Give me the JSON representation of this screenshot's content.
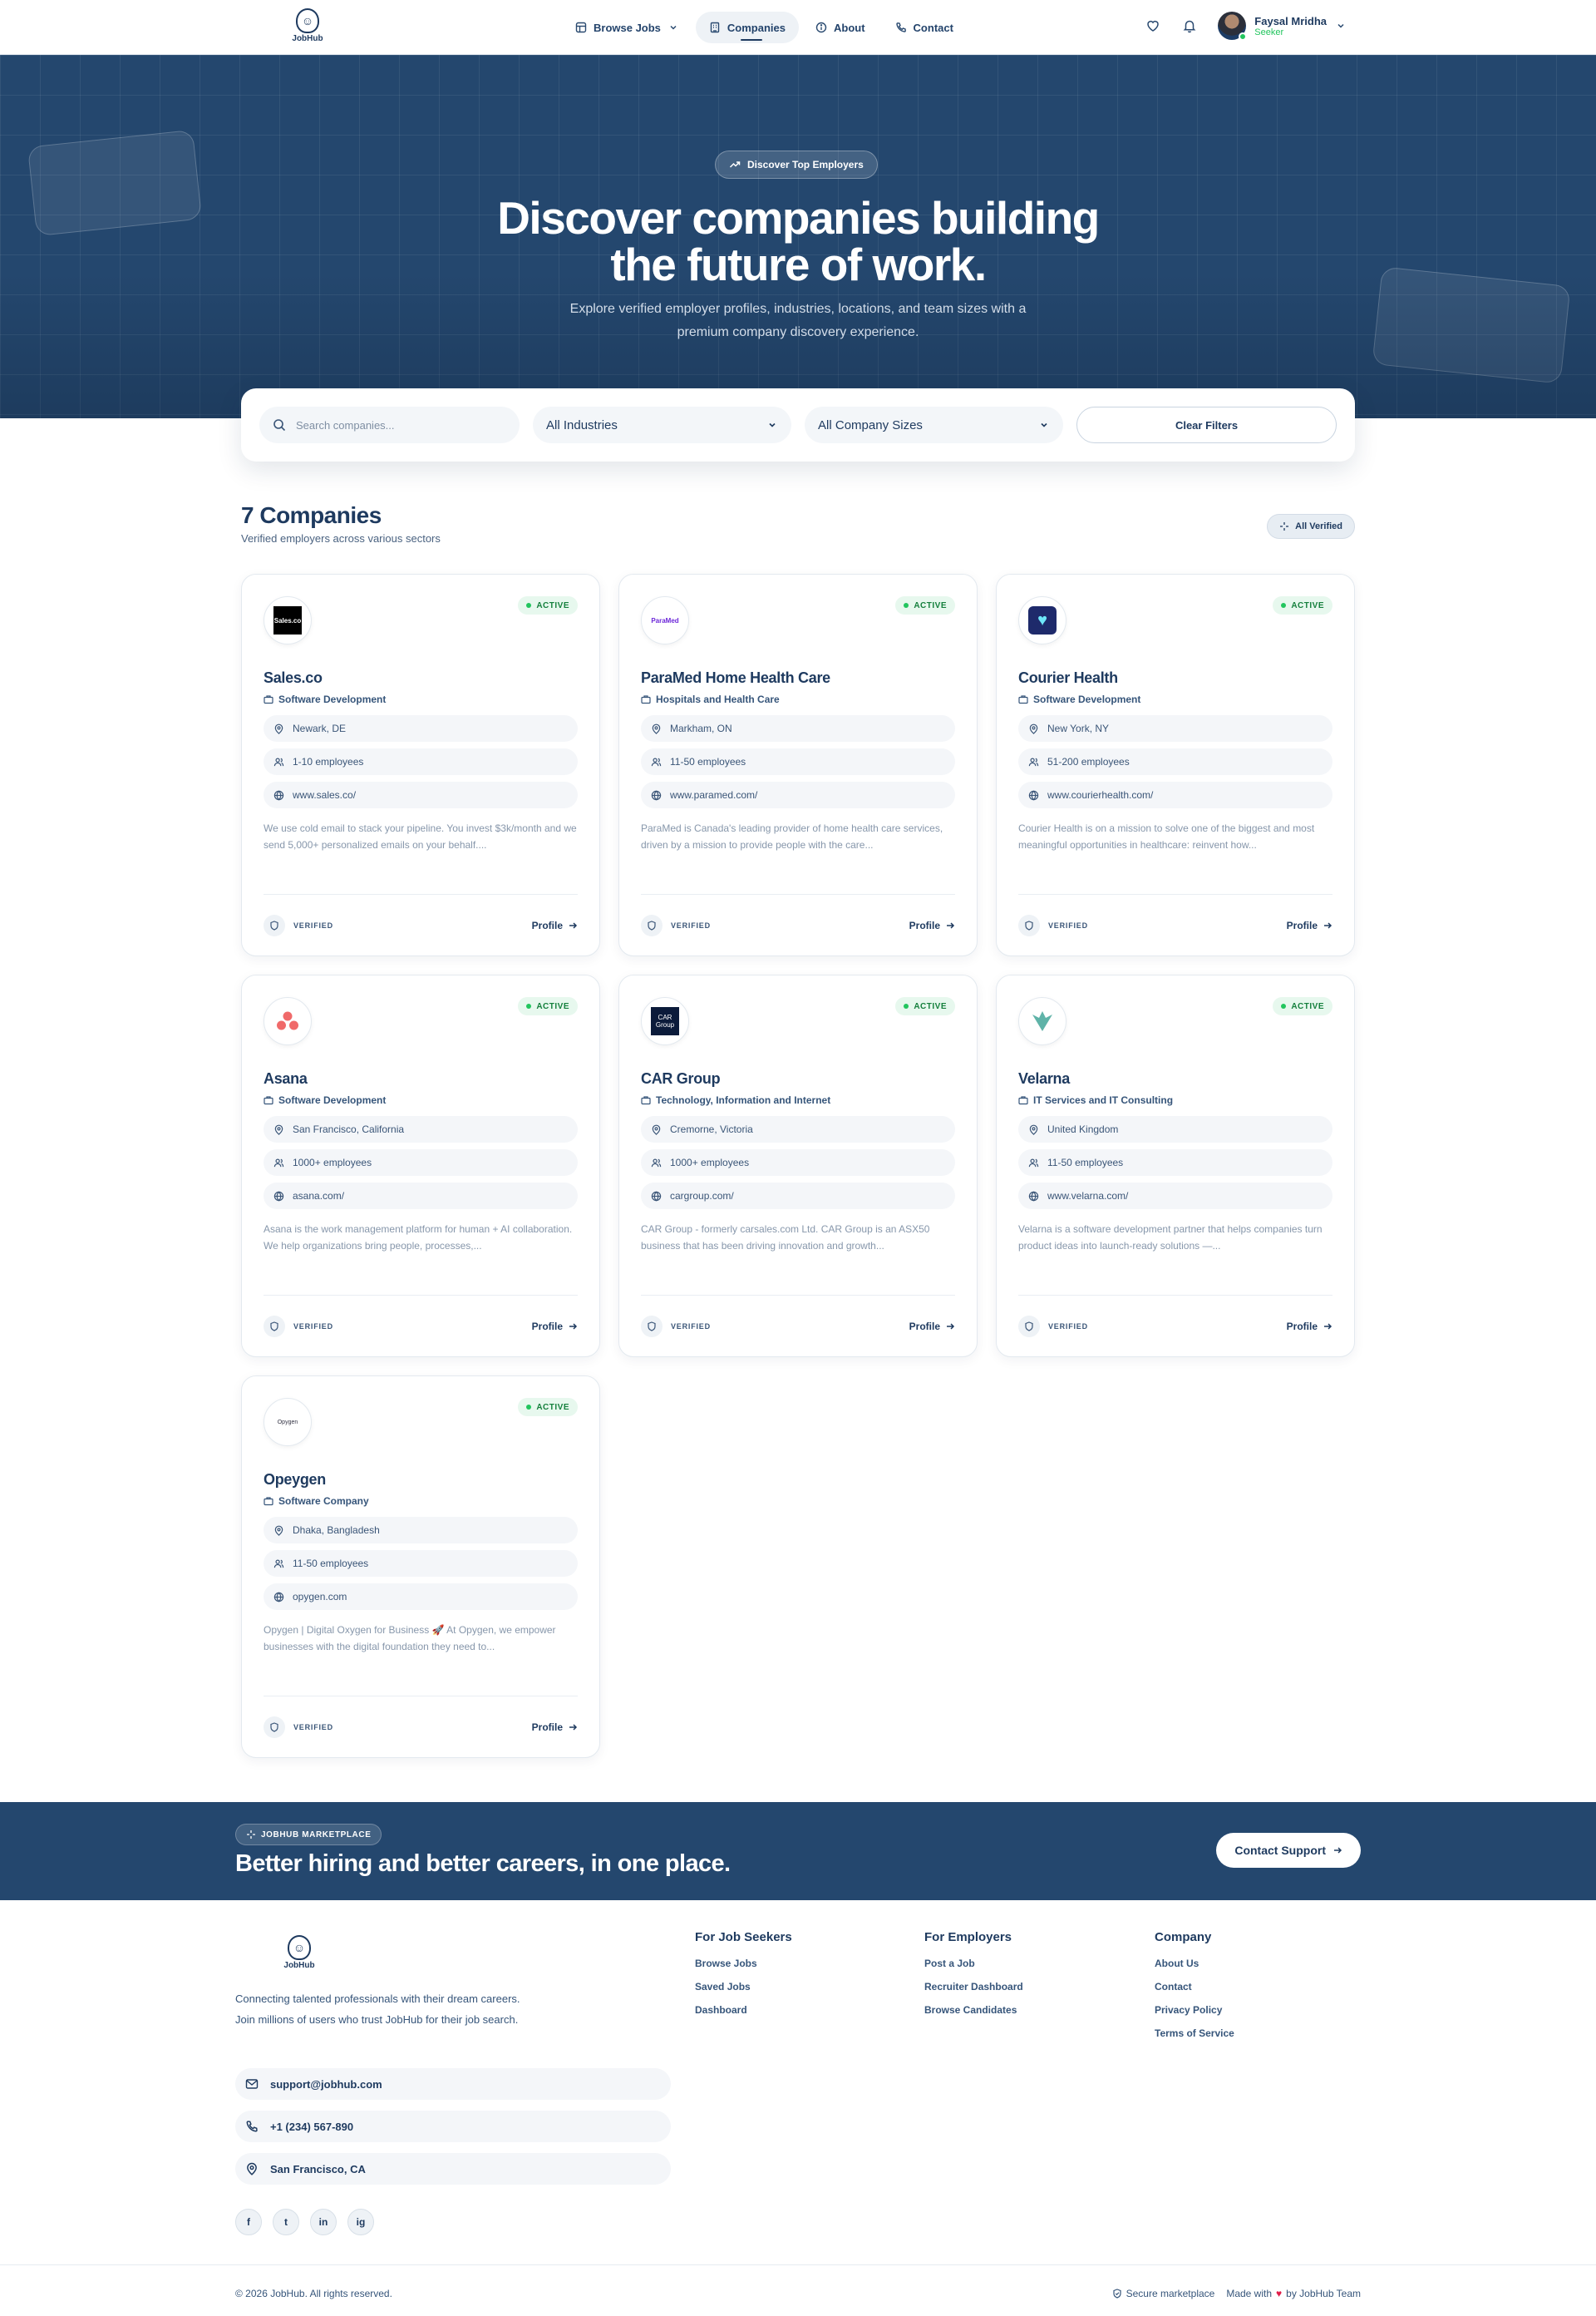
{
  "nav": {
    "logo_text": "JobHub",
    "items": [
      {
        "label": "Browse Jobs"
      },
      {
        "label": "Companies"
      },
      {
        "label": "About"
      },
      {
        "label": "Contact"
      }
    ],
    "user": {
      "name": "Faysal Mridha",
      "role": "Seeker"
    }
  },
  "hero": {
    "pill": "Discover Top Employers",
    "title_line1": "Discover companies building",
    "title_line2": "the future of work.",
    "subtitle_line1": "Explore verified employer profiles, industries, locations, and team sizes with a",
    "subtitle_line2": "premium company discovery experience."
  },
  "filters": {
    "search_placeholder": "Search companies...",
    "industry": "All Industries",
    "size": "All Company Sizes",
    "clear": "Clear Filters"
  },
  "list": {
    "count_title": "7 Companies",
    "subtitle": "Verified employers across various sectors",
    "verified_chip": "All Verified"
  },
  "card_labels": {
    "status": "ACTIVE",
    "verified": "VERIFIED",
    "profile": "Profile"
  },
  "companies": [
    {
      "name": "Sales.co",
      "industry": "Software Development",
      "location": "Newark, DE",
      "size": "1-10 employees",
      "website": "www.sales.co/",
      "description": "We use cold email to stack your pipeline. You invest $3k/month and we send 5,000+ personalized emails on your behalf....",
      "logo_text": "Sales.co"
    },
    {
      "name": "ParaMed Home Health Care",
      "industry": "Hospitals and Health Care",
      "location": "Markham, ON",
      "size": "11-50 employees",
      "website": "www.paramed.com/",
      "description": "ParaMed is Canada's leading provider of home health care services, driven by a mission to provide people with the care...",
      "logo_text": "ParaMed"
    },
    {
      "name": "Courier Health",
      "industry": "Software Development",
      "location": "New York, NY",
      "size": "51-200 employees",
      "website": "www.courierhealth.com/",
      "description": "Courier Health is on a mission to solve one of the biggest and most meaningful opportunities in healthcare: reinvent how...",
      "logo_text": ""
    },
    {
      "name": "Asana",
      "industry": "Software Development",
      "location": "San Francisco, California",
      "size": "1000+ employees",
      "website": "asana.com/",
      "description": "Asana is the work management platform for human + AI collaboration. We help organizations bring people, processes,...",
      "logo_text": ""
    },
    {
      "name": "CAR Group",
      "industry": "Technology, Information and Internet",
      "location": "Cremorne, Victoria",
      "size": "1000+ employees",
      "website": "cargroup.com/",
      "description": "CAR Group - formerly carsales.com Ltd. CAR Group is an ASX50 business that has been driving innovation and growth...",
      "logo_text": "CAR Group"
    },
    {
      "name": "Velarna",
      "industry": "IT Services and IT Consulting",
      "location": "United Kingdom",
      "size": "11-50 employees",
      "website": "www.velarna.com/",
      "description": "Velarna is a software development partner that helps companies turn product ideas into launch-ready solutions —...",
      "logo_text": ""
    },
    {
      "name": "Opeygen",
      "industry": "Software Company",
      "location": "Dhaka, Bangladesh",
      "size": "11-50 employees",
      "website": "opygen.com",
      "description": "Opygen | Digital Oxygen for Business 🚀 At Opygen, we empower businesses with the digital foundation they need to...",
      "logo_text": "Opygen"
    }
  ],
  "band": {
    "tag": "JOBHUB MARKETPLACE",
    "title": "Better hiring and better careers, in one place.",
    "button": "Contact Support"
  },
  "footer": {
    "logo_text": "JobHub",
    "about": "Connecting talented professionals with their dream careers. Join millions of users who trust JobHub for their job search.",
    "email": "support@jobhub.com",
    "phone": "+1 (234) 567-890",
    "address": "San Francisco, CA",
    "socials": [
      "f",
      "t",
      "in",
      "ig"
    ],
    "columns": [
      {
        "title": "For Job Seekers",
        "links": [
          "Browse Jobs",
          "Saved Jobs",
          "Dashboard"
        ]
      },
      {
        "title": "For Employers",
        "links": [
          "Post a Job",
          "Recruiter Dashboard",
          "Browse Candidates"
        ]
      },
      {
        "title": "Company",
        "links": [
          "About Us",
          "Contact",
          "Privacy Policy",
          "Terms of Service"
        ]
      }
    ],
    "copyright": "© 2026 JobHub. All rights reserved.",
    "secure": "Secure marketplace",
    "made_with_prefix": "Made with",
    "made_with_suffix": "by JobHub Team"
  },
  "colors": {
    "primary": "#1e3a5f",
    "hero": "#24476e",
    "success": "#22c55e"
  }
}
